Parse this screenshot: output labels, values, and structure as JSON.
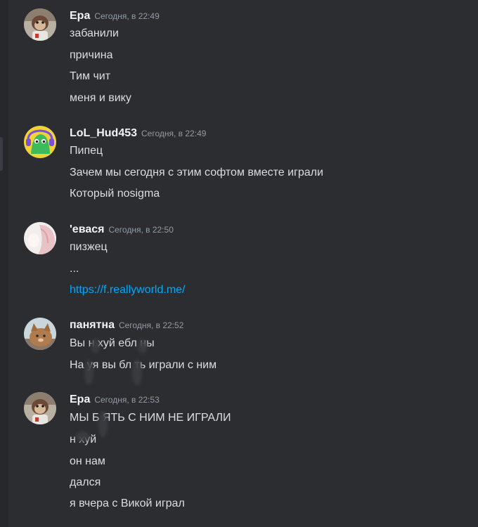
{
  "messages": [
    {
      "username": "Ера",
      "timestamp": "Сегодня, в 22:49",
      "avatar_icon": "monkey-avatar-icon",
      "lines": [
        "забанили",
        "причина",
        "Тим чит",
        "меня и вику"
      ]
    },
    {
      "username": "LoL_Hud453",
      "timestamp": "Сегодня, в 22:49",
      "avatar_icon": "green-bot-avatar-icon",
      "lines": [
        "Пипец",
        "Зачем мы сегодня с этим софтом вместе играли",
        "Который nosigma"
      ]
    },
    {
      "username": "'евася",
      "timestamp": "Сегодня, в 22:50",
      "avatar_icon": "anime-avatar-icon",
      "lines": [
        "пизжец",
        "...",
        "https://f.reallyworld.me/"
      ]
    },
    {
      "username": "панятна",
      "timestamp": "Сегодня, в 22:52",
      "avatar_icon": "cat-avatar-icon",
      "lines": [
        "Вы н хуй ебл ны",
        "На уя вы бл ть играли с ним"
      ]
    },
    {
      "username": "Ера",
      "timestamp": "Сегодня, в 22:53",
      "avatar_icon": "monkey-avatar-icon",
      "lines": [
        "МЫ Б ЯТЬ С НИМ НЕ ИГРАЛИ",
        "н хуй",
        "он нам",
        "дался",
        "я вчера с Викой играл"
      ]
    }
  ],
  "colors": {
    "background": "#2b2d31",
    "text": "#dbdee1",
    "username": "#f2f3f5",
    "timestamp": "#949ba4",
    "link": "#00a8fc"
  }
}
